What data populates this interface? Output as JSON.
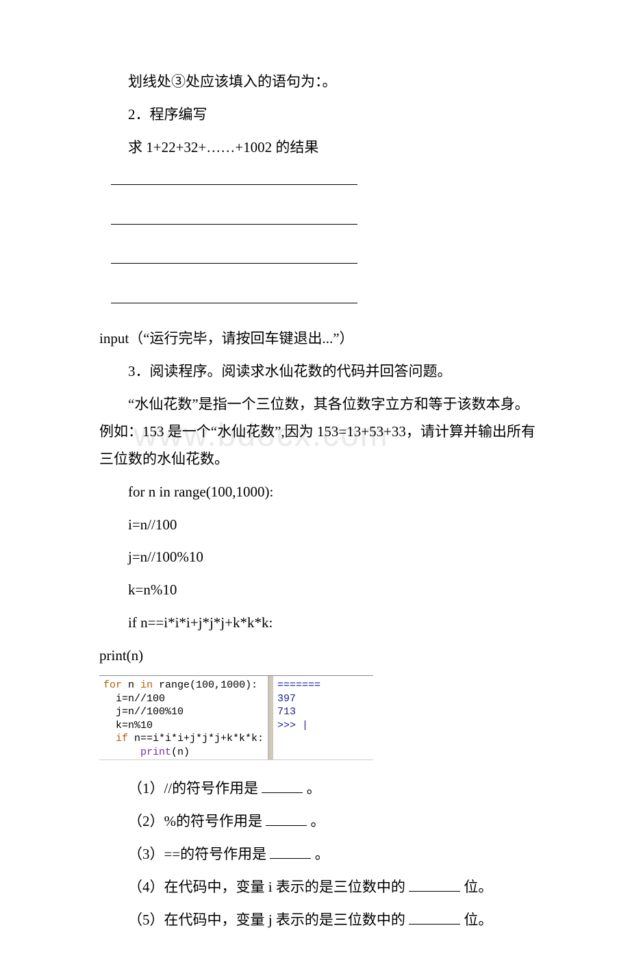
{
  "body": {
    "line1": "划线处③处应该填入的语句为：。",
    "line2": "2．程序编写",
    "line3": "求 1+22+32+……+1002 的结果",
    "input_line": "input（“运行完毕，请按回车键退出...”）",
    "line_read": "3．阅读程序。阅读求水仙花数的代码并回答问题。",
    "narcissus_desc": "“水仙花数”是指一个三位数，其各位数字立方和等于该数本身。例如：153 是一个“水仙花数”,因为 153=13+53+33，请计算并输出所有三位数的水仙花数。",
    "code": {
      "l1": "for n in range(100,1000):",
      "l2": "i=n//100",
      "l3": "j=n//100%10",
      "l4": "k=n%10",
      "l5": "if n==i*i*i+j*j*j+k*k*k:",
      "l6": "print(n)"
    },
    "code_img": {
      "left_l1_for": "for",
      "left_l1_rest": " n ",
      "left_l1_in": "in",
      "left_l1_tail": " range(100,1000):",
      "left_l2": "  i=n//100",
      "left_l3": "  j=n//100%10",
      "left_l4": "  k=n%10",
      "left_l5_if": "  if",
      "left_l5_tail": " n==i*i*i+j*j*j+k*k*k:",
      "left_l6_print": "      print",
      "left_l6_tail": "(n)",
      "right_l0": "=======",
      "right_l1": "397",
      "right_l2": "713",
      "right_l3": ">>> |"
    },
    "q1_a": "（1）//的符号作用是 ",
    "q1_b": " 。",
    "q2_a": "（2）%的符号作用是 ",
    "q2_b": " 。",
    "q3_a": "（3）==的符号作用是 ",
    "q3_b": " 。",
    "q4_a": "（4）在代码中，变量 i 表示的是三位数中的 ",
    "q4_b": " 位。",
    "q5_a": "（5）在代码中，变量 j 表示的是三位数中的 ",
    "q5_b": " 位。"
  },
  "watermark": "www.bdocx.com"
}
